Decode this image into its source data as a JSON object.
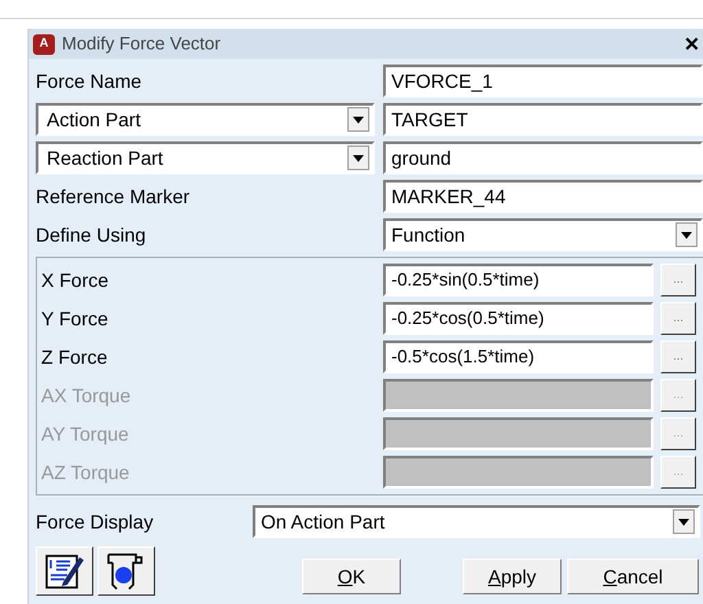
{
  "window": {
    "title": "Modify Force Vector",
    "app_icon": "A",
    "close": "✕"
  },
  "header_rows": [
    {
      "label": {
        "kind": "text",
        "text": "Force Name"
      },
      "value": {
        "kind": "text",
        "text": "VFORCE_1"
      }
    },
    {
      "label": {
        "kind": "dropdown",
        "text": "Action Part"
      },
      "value": {
        "kind": "text",
        "text": "TARGET"
      }
    },
    {
      "label": {
        "kind": "dropdown",
        "text": "Reaction Part"
      },
      "value": {
        "kind": "text",
        "text": "ground"
      }
    },
    {
      "label": {
        "kind": "text",
        "text": "Reference Marker"
      },
      "value": {
        "kind": "text",
        "text": "MARKER_44"
      }
    },
    {
      "label": {
        "kind": "text",
        "text": "Define Using"
      },
      "value": {
        "kind": "dropdown",
        "text": "Function"
      }
    }
  ],
  "components": [
    {
      "label": "X Force",
      "value": "-0.25*sin(0.5*time)",
      "disabled": false,
      "browse": "..."
    },
    {
      "label": "Y Force",
      "value": "-0.25*cos(0.5*time)",
      "disabled": false,
      "browse": "..."
    },
    {
      "label": "Z Force",
      "value": "-0.5*cos(1.5*time)",
      "disabled": false,
      "browse": "..."
    },
    {
      "label": "AX Torque",
      "disabled": true,
      "browse": "..."
    },
    {
      "label": "AY Torque",
      "disabled": true,
      "browse": "..."
    },
    {
      "label": "AZ Torque",
      "disabled": true,
      "browse": "..."
    }
  ],
  "force_display": {
    "label": "Force Display",
    "value": "On Action Part"
  },
  "buttons": [
    {
      "label": "OK"
    },
    {
      "label": "Apply"
    },
    {
      "label": "Cancel"
    }
  ]
}
